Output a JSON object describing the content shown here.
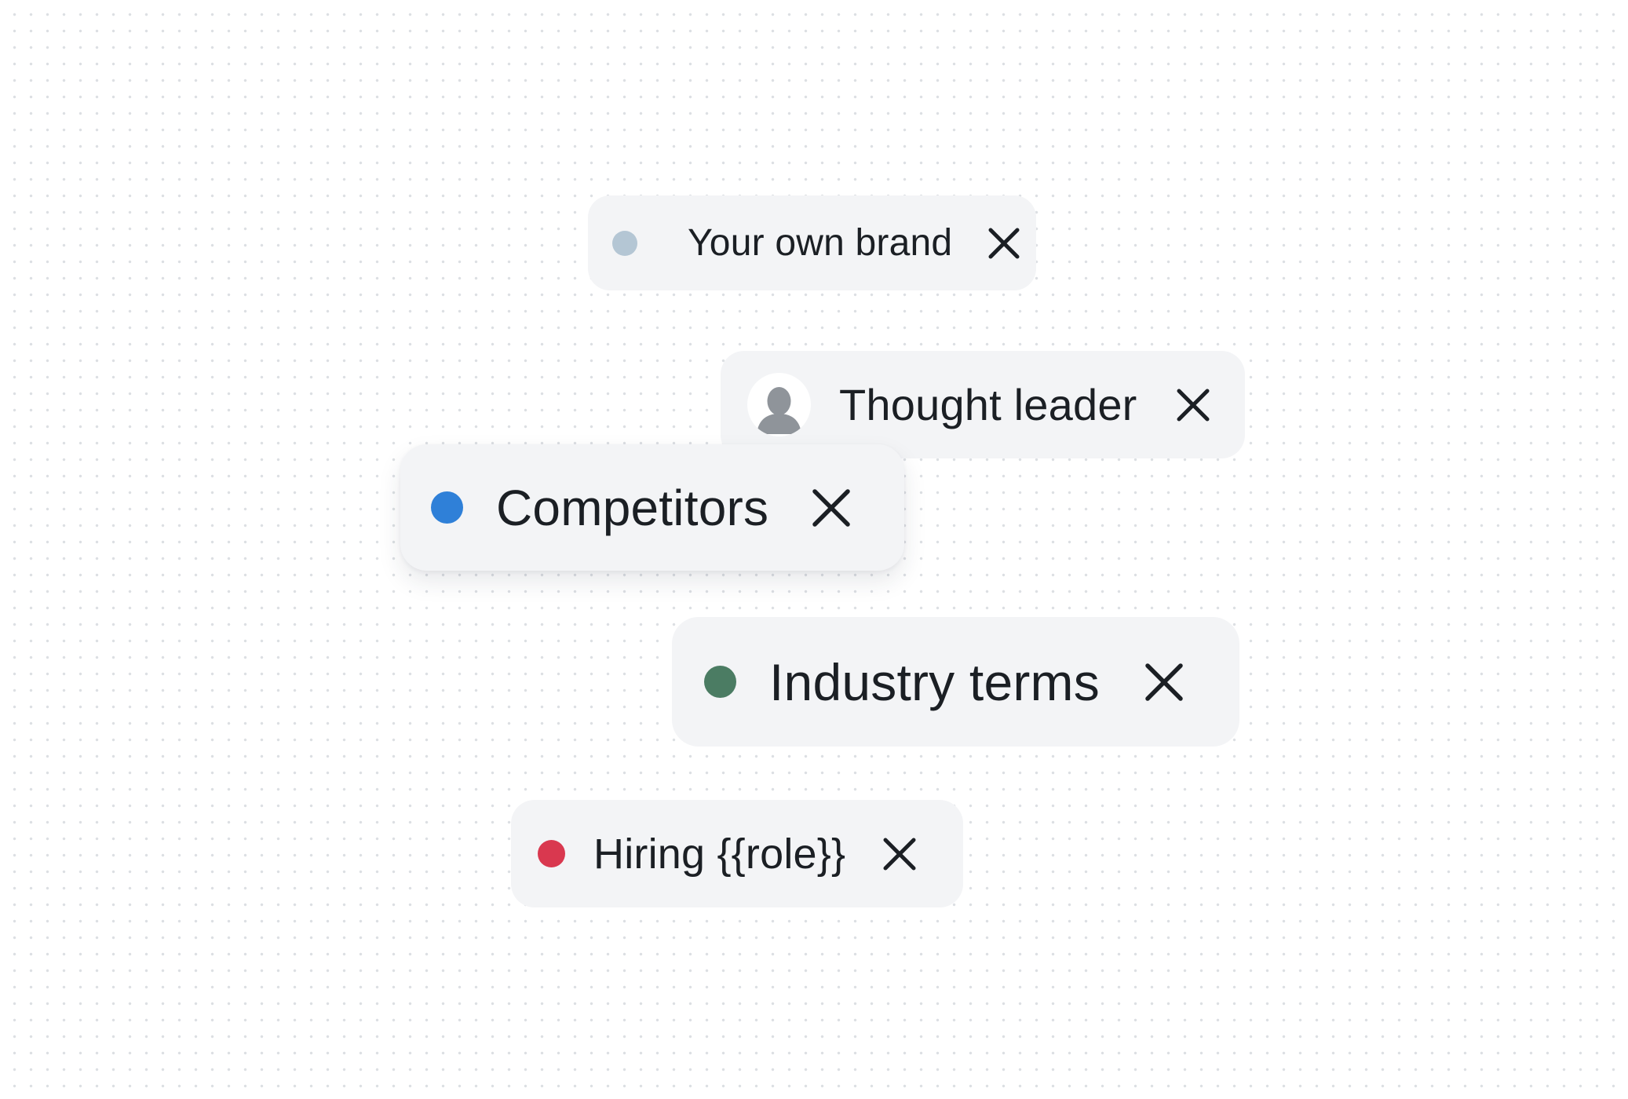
{
  "tags": [
    {
      "label": "Your own brand",
      "dot_color": "#b4c6d4",
      "icon": "status-dot-icon",
      "remove_icon": "close-icon"
    },
    {
      "label": "Thought leader",
      "icon": "user-avatar-icon",
      "remove_icon": "close-icon"
    },
    {
      "label": "Competitors",
      "dot_color": "#2f80d8",
      "icon": "status-dot-icon",
      "remove_icon": "close-icon"
    },
    {
      "label": "Industry terms",
      "dot_color": "#4b7c63",
      "icon": "status-dot-icon",
      "remove_icon": "close-icon"
    },
    {
      "label": "Hiring {{role}}",
      "dot_color": "#d9384f",
      "icon": "status-dot-icon",
      "remove_icon": "close-icon"
    }
  ],
  "colors": {
    "tag_background": "#f3f4f6",
    "text": "#1b1f24",
    "background_dots": "#dcdfe3"
  }
}
